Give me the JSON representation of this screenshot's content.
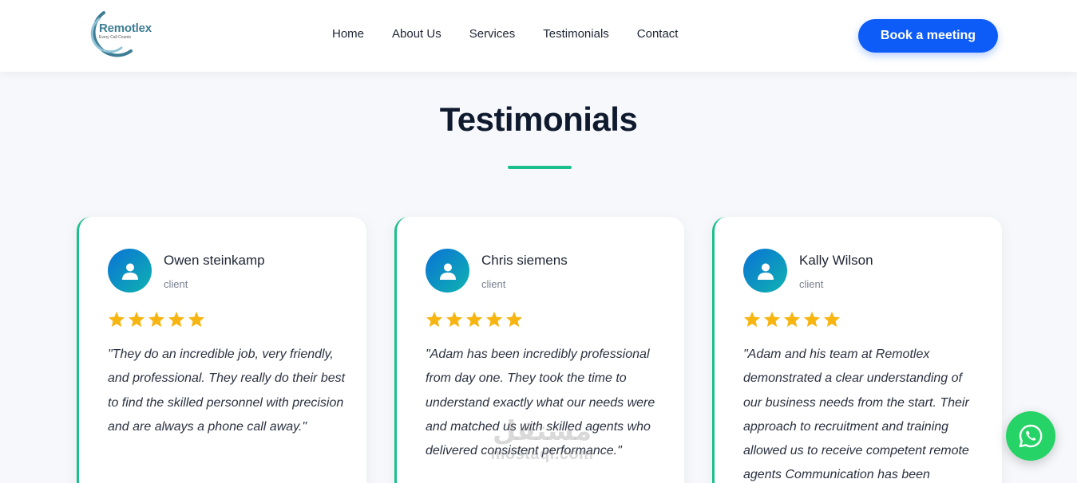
{
  "header": {
    "logo": {
      "name": "Remotlex",
      "tagline": "Every Call Counts"
    },
    "nav": [
      "Home",
      "About Us",
      "Services",
      "Testimonials",
      "Contact"
    ],
    "cta_label": "Book a meeting"
  },
  "section": {
    "title": "Testimonials"
  },
  "testimonials": [
    {
      "name": "Owen steinkamp",
      "role": "client",
      "rating": 5,
      "quote": "\"They do an incredible job, very friendly, and professional. They really do their best to find the skilled personnel with precision and are always a phone call away.\""
    },
    {
      "name": "Chris siemens",
      "role": "client",
      "rating": 5,
      "quote": "\"Adam has been incredibly professional from day one. They took the time to understand exactly what our needs were and matched us with skilled agents who delivered consistent performance.\""
    },
    {
      "name": "Kally Wilson",
      "role": "client",
      "rating": 5,
      "quote": "\"Adam and his team at Remotlex demonstrated a clear understanding of our business needs from the start. Their approach to recruitment and training allowed us to receive competent remote agents Communication has been"
    }
  ],
  "watermark": {
    "arabic": "مستقل",
    "latin": "mostaql.com"
  },
  "colors": {
    "accent": "#1bbf8c",
    "primary": "#0d5cf7",
    "star": "#f7b511",
    "whatsapp": "#25d366"
  },
  "icons": {
    "avatar": "user-icon",
    "star": "star-icon",
    "floating": "whatsapp-icon"
  }
}
